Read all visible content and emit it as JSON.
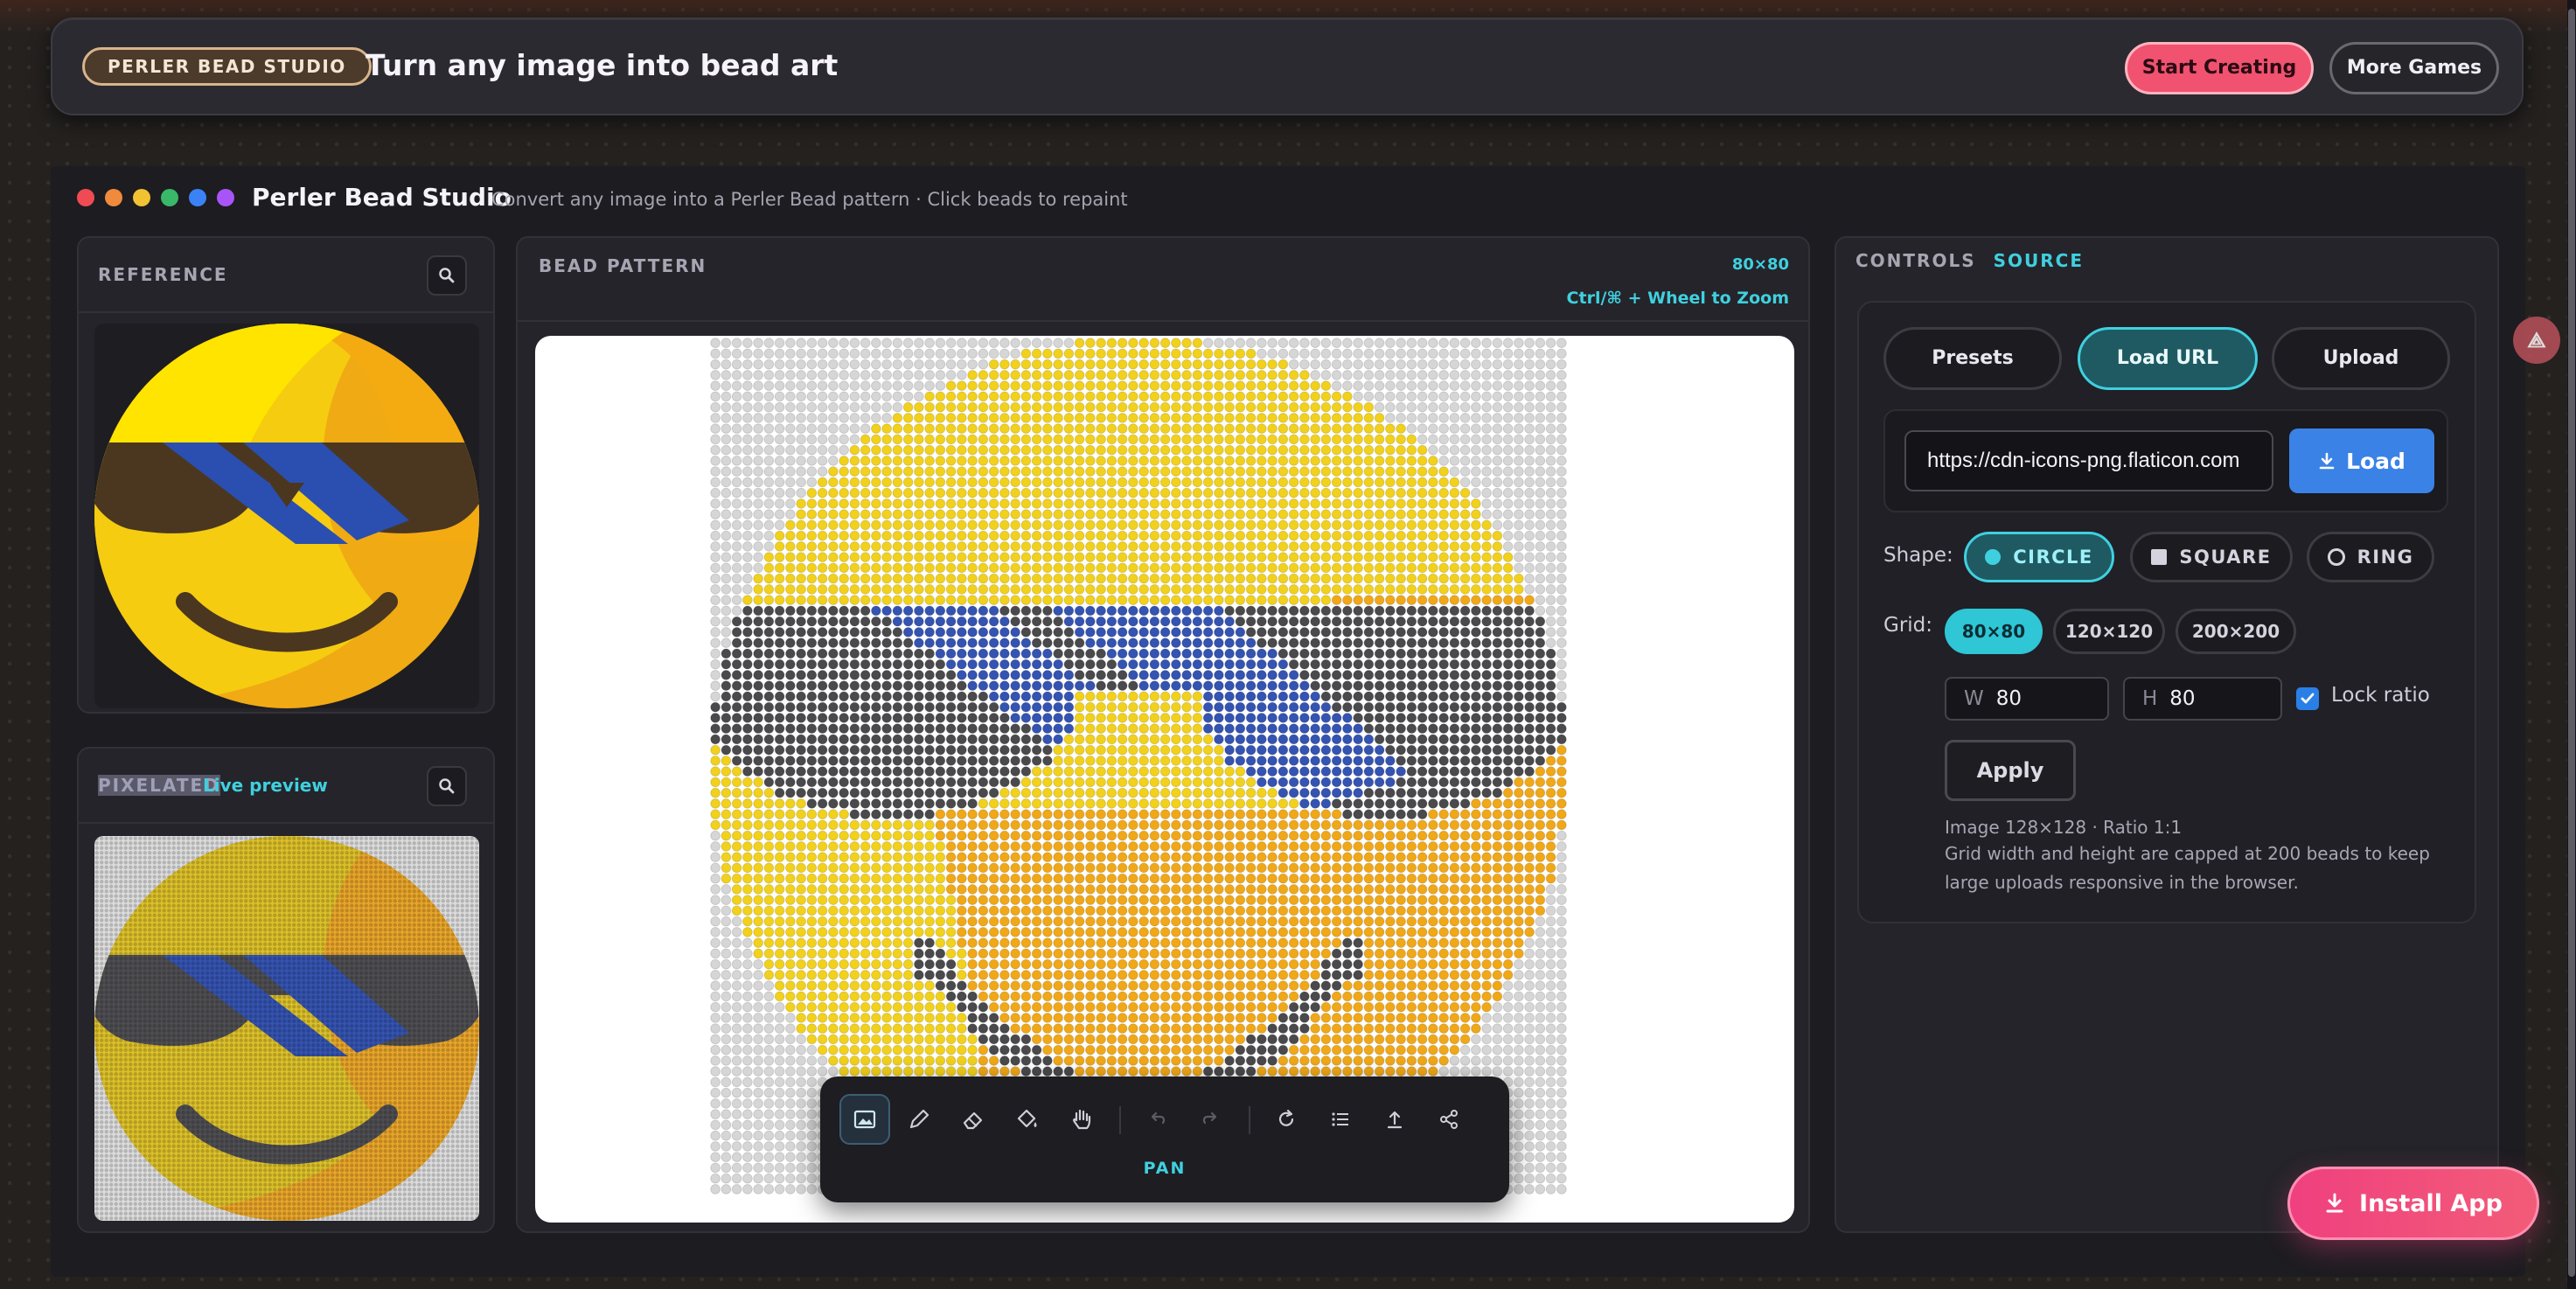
{
  "header": {
    "brand": "PERLER BEAD STUDIO",
    "tagline": "Turn any image into bead art",
    "start_button": "Start Creating",
    "more_button": "More Games"
  },
  "app": {
    "title": "Perler Bead Studio",
    "subtitle": "Convert any image into a Perler Bead pattern · Click beads to repaint",
    "window_dot_colors": [
      "#f04b54",
      "#f08a3c",
      "#f1c232",
      "#39b86a",
      "#3b82f6",
      "#a855f7"
    ]
  },
  "reference": {
    "label": "REFERENCE",
    "zoom_icon": "magnifier-icon"
  },
  "pixelated": {
    "label": "PIXELATED",
    "status": "Live preview",
    "zoom_icon": "magnifier-icon"
  },
  "pattern": {
    "label": "BEAD PATTERN",
    "grid_size": "80×80",
    "zoom_hint": "Ctrl/⌘ + Wheel to Zoom",
    "mode_label": "PAN",
    "tools": [
      {
        "name": "image-tool",
        "icon": "image-icon",
        "active": true
      },
      {
        "name": "pencil-tool",
        "icon": "pencil-icon"
      },
      {
        "name": "eraser-tool",
        "icon": "eraser-icon"
      },
      {
        "name": "fill-tool",
        "icon": "paint-bucket-icon"
      },
      {
        "name": "pan-tool",
        "icon": "hand-icon"
      },
      {
        "name": "undo-tool",
        "icon": "undo-icon",
        "disabled": true
      },
      {
        "name": "redo-tool",
        "icon": "redo-icon",
        "disabled": true
      },
      {
        "name": "reset-tool",
        "icon": "refresh-icon"
      },
      {
        "name": "list-tool",
        "icon": "list-icon"
      },
      {
        "name": "export-tool",
        "icon": "upload-icon"
      },
      {
        "name": "share-tool",
        "icon": "share-icon"
      }
    ]
  },
  "controls": {
    "tab_controls": "CONTROLS",
    "tab_source": "SOURCE",
    "source_tabs": [
      "Presets",
      "Load URL",
      "Upload"
    ],
    "active_source_tab": "Load URL",
    "url_value": "https://cdn-icons-png.flaticon.com",
    "load_button": "Load",
    "shape_label": "Shape:",
    "shapes": [
      "CIRCLE",
      "SQUARE",
      "RING"
    ],
    "active_shape": "CIRCLE",
    "grid_label": "Grid:",
    "grid_options": [
      "80×80",
      "120×120",
      "200×200"
    ],
    "active_grid": "80×80",
    "width_prefix": "W",
    "width_value": "80",
    "height_prefix": "H",
    "height_value": "80",
    "lock_ratio_label": "Lock ratio",
    "lock_ratio_checked": true,
    "apply_button": "Apply",
    "image_info": "Image 128×128 · Ratio 1:1",
    "note": "Grid width and height are capped at 200 beads to keep large uploads responsive in the browser."
  },
  "install_button": "Install App",
  "colors": {
    "accent": "#3fd0df",
    "pink": "#f0526f",
    "blue_button": "#3b82e6",
    "face_yellow": "#f1d11c",
    "face_orange": "#f0a818",
    "glasses_dark": "#4a4a4d",
    "lens_blue": "#3553b0",
    "empty_bead": "#d6d6d6"
  }
}
